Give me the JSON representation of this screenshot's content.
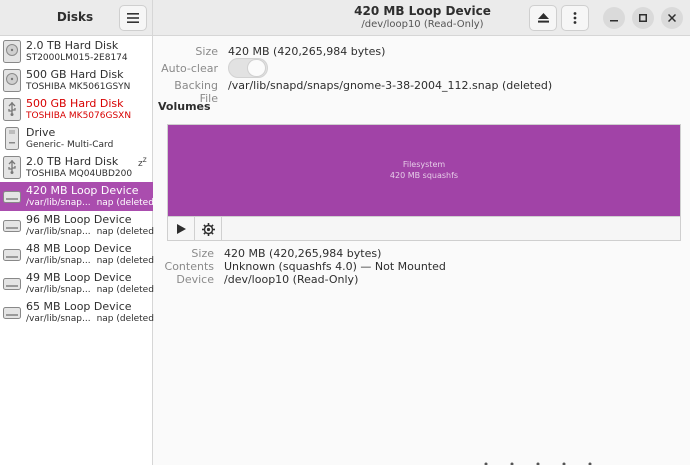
{
  "sidebar": {
    "title": "Disks",
    "items": [
      {
        "name": "2.0 TB Hard Disk",
        "sub": "ST2000LM015-2E8174",
        "sub2": "",
        "icon": "hard-disk-icon"
      },
      {
        "name": "500 GB Hard Disk",
        "sub": "TOSHIBA MK5061GSYN",
        "sub2": "",
        "icon": "hard-disk-icon"
      },
      {
        "name": "500 GB Hard Disk",
        "sub": "TOSHIBA MK5076GSXN",
        "sub2": "",
        "icon": "usb-drive-icon"
      },
      {
        "name": "Drive",
        "sub": "Generic- Multi-Card",
        "sub2": "",
        "icon": "card-reader-icon"
      },
      {
        "name": "2.0 TB Hard Disk",
        "sub": "TOSHIBA MQ04UBD200",
        "sub2": "",
        "icon": "usb-drive-icon"
      },
      {
        "name": "420 MB Loop Device",
        "sub": "/var/lib/snap...",
        "sub2": "nap (deleted)",
        "icon": "loop-device-icon"
      },
      {
        "name": "96 MB Loop Device",
        "sub": "/var/lib/snap...",
        "sub2": "nap (deleted)",
        "icon": "loop-device-icon"
      },
      {
        "name": "48 MB Loop Device",
        "sub": "/var/lib/snap...",
        "sub2": "nap (deleted)",
        "icon": "loop-device-icon"
      },
      {
        "name": "49 MB Loop Device",
        "sub": "/var/lib/snap...",
        "sub2": "nap (deleted)",
        "icon": "loop-device-icon"
      },
      {
        "name": "65 MB Loop Device",
        "sub": "/var/lib/snap...",
        "sub2": "nap (deleted)",
        "icon": "loop-device-icon"
      }
    ]
  },
  "header": {
    "title": "420 MB Loop Device",
    "subtitle": "/dev/loop10 (Read-Only)"
  },
  "drive": {
    "size_label": "Size",
    "size_value": "420 MB (420,265,984 bytes)",
    "autoclear_label": "Auto-clear",
    "backing_label": "Backing File",
    "backing_value": "/var/lib/snapd/snaps/gnome-3-38-2004_112.snap (deleted)"
  },
  "volumes": {
    "title": "Volumes",
    "fs_line1": "Filesystem",
    "fs_line2": "420 MB squashfs"
  },
  "partition": {
    "size_label": "Size",
    "size_value": "420 MB (420,265,984 bytes)",
    "contents_label": "Contents",
    "contents_value": "Unknown (squashfs 4.0) — Not Mounted",
    "device_label": "Device",
    "device_value": "/dev/loop10 (Read-Only)"
  },
  "colors": {
    "accent": "#aa4dae",
    "volume": "#a143a7",
    "warning": "#d70000"
  }
}
